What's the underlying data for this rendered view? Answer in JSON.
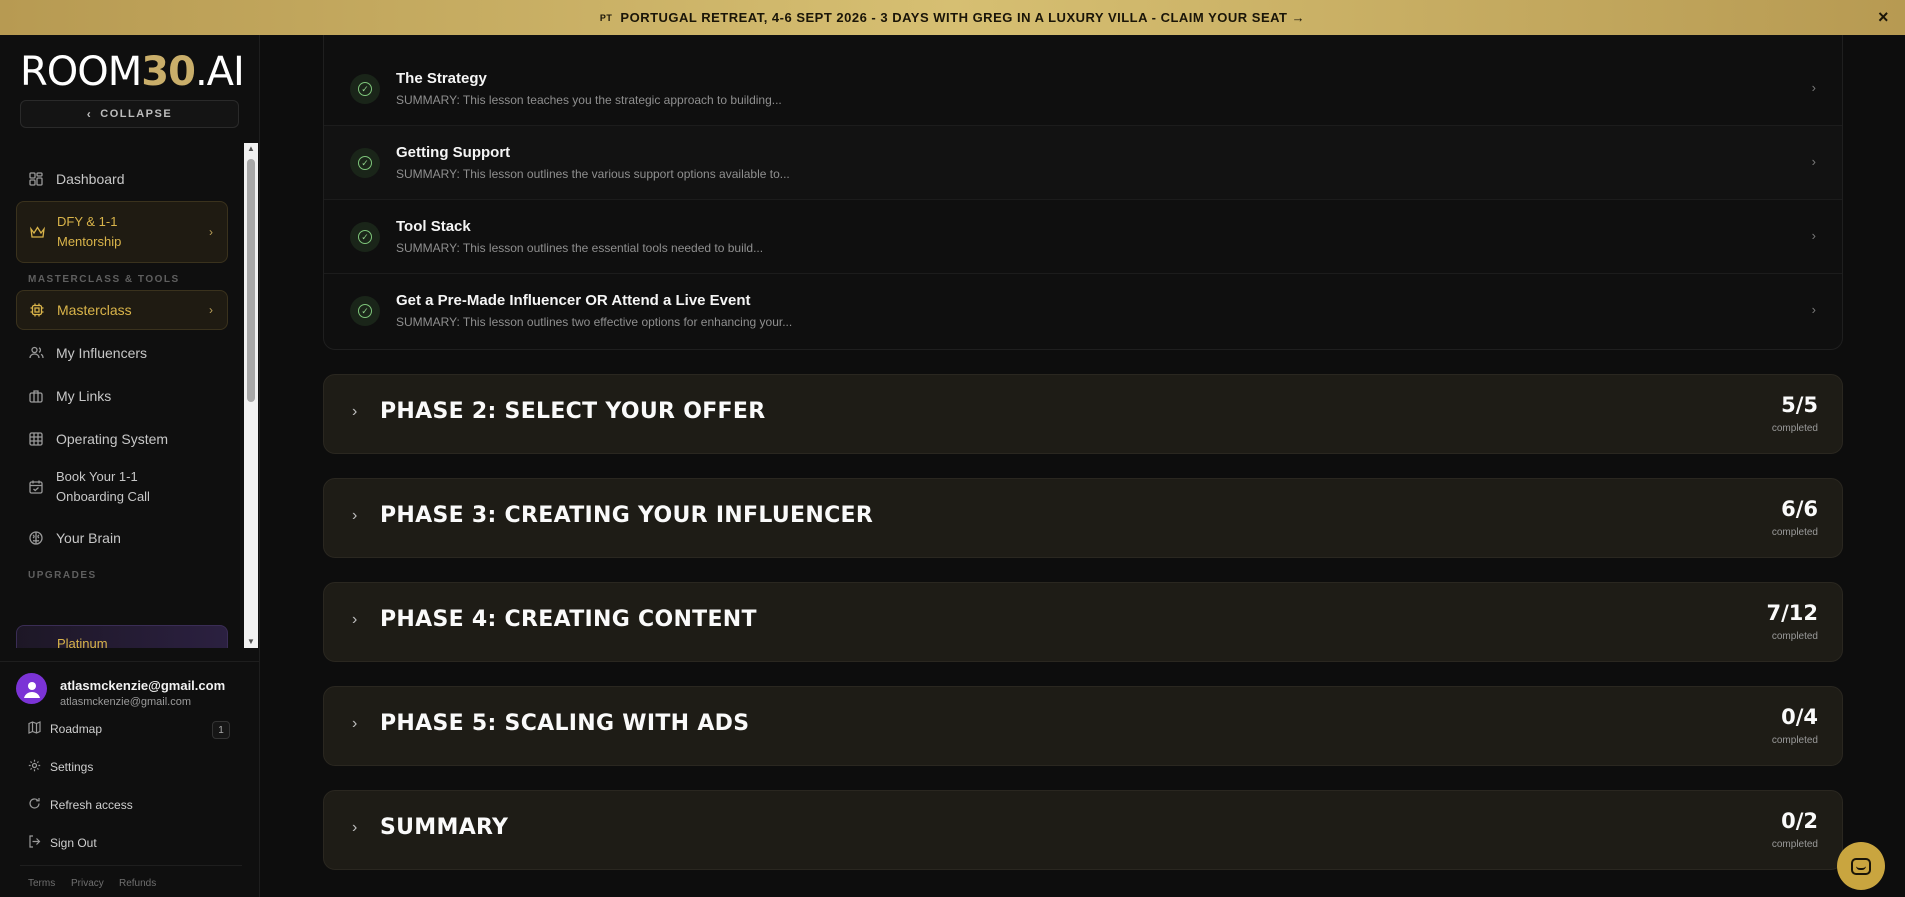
{
  "banner": {
    "flag": "PT",
    "text": "PORTUGAL RETREAT, 4-6 SEPT 2026 - 3 DAYS WITH GREG IN A LUXURY VILLA - CLAIM YOUR SEAT →",
    "close": "×"
  },
  "brand": {
    "logo_a": "ROOM",
    "logo_b": "30",
    "logo_c": ".AI",
    "collapse": "COLLAPSE"
  },
  "sidebar": {
    "items": [
      {
        "label": "Dashboard",
        "icon": "grid-icon"
      },
      {
        "label": "DFY & 1-1\nMentorship",
        "icon": "crown-icon"
      },
      {
        "label": "Masterclass",
        "icon": "chip-icon"
      },
      {
        "label": "My Influencers",
        "icon": "users-icon"
      },
      {
        "label": "My Links",
        "icon": "briefcase-icon"
      },
      {
        "label": "Operating System",
        "icon": "table-icon"
      },
      {
        "label": "Book Your 1-1\nOnboarding Call",
        "icon": "calendar-icon"
      },
      {
        "label": "Your Brain",
        "icon": "brain-icon"
      }
    ],
    "section_tools": "MASTERCLASS & TOOLS",
    "section_upgrades": "UPGRADES",
    "upgrade_card": "Platinum"
  },
  "user": {
    "name": "atlasmckenzie@gmail.com",
    "email": "atlasmckenzie@gmail.com"
  },
  "footer": {
    "roadmap": "Roadmap",
    "roadmap_badge": "1",
    "settings": "Settings",
    "refresh": "Refresh access",
    "signout": "Sign Out",
    "terms": "Terms",
    "privacy": "Privacy",
    "refunds": "Refunds"
  },
  "lessons": [
    {
      "title": "The Strategy",
      "summary": "SUMMARY: This lesson teaches you the strategic approach to building..."
    },
    {
      "title": "Getting Support",
      "summary": "SUMMARY: This lesson outlines the various support options available to..."
    },
    {
      "title": "Tool Stack",
      "summary": "SUMMARY: This lesson outlines the essential tools needed to build..."
    },
    {
      "title": "Get a Pre-Made Influencer OR Attend a Live Event",
      "summary": "SUMMARY: This lesson outlines two effective options for enhancing your..."
    }
  ],
  "phases": [
    {
      "title": "PHASE 2: SELECT YOUR OFFER",
      "count": "5/5",
      "status": "completed"
    },
    {
      "title": "PHASE 3: CREATING YOUR INFLUENCER",
      "count": "6/6",
      "status": "completed"
    },
    {
      "title": "PHASE 4: CREATING CONTENT",
      "count": "7/12",
      "status": "completed"
    },
    {
      "title": "PHASE 5: SCALING WITH ADS",
      "count": "0/4",
      "status": "completed"
    },
    {
      "title": "SUMMARY",
      "count": "0/2",
      "status": "completed"
    }
  ],
  "colors": {
    "accent_gold": "#d9b44a",
    "banner_gold": "#c9ae6a",
    "check_green": "#7ec57a",
    "avatar_purple": "#7b33d6"
  }
}
